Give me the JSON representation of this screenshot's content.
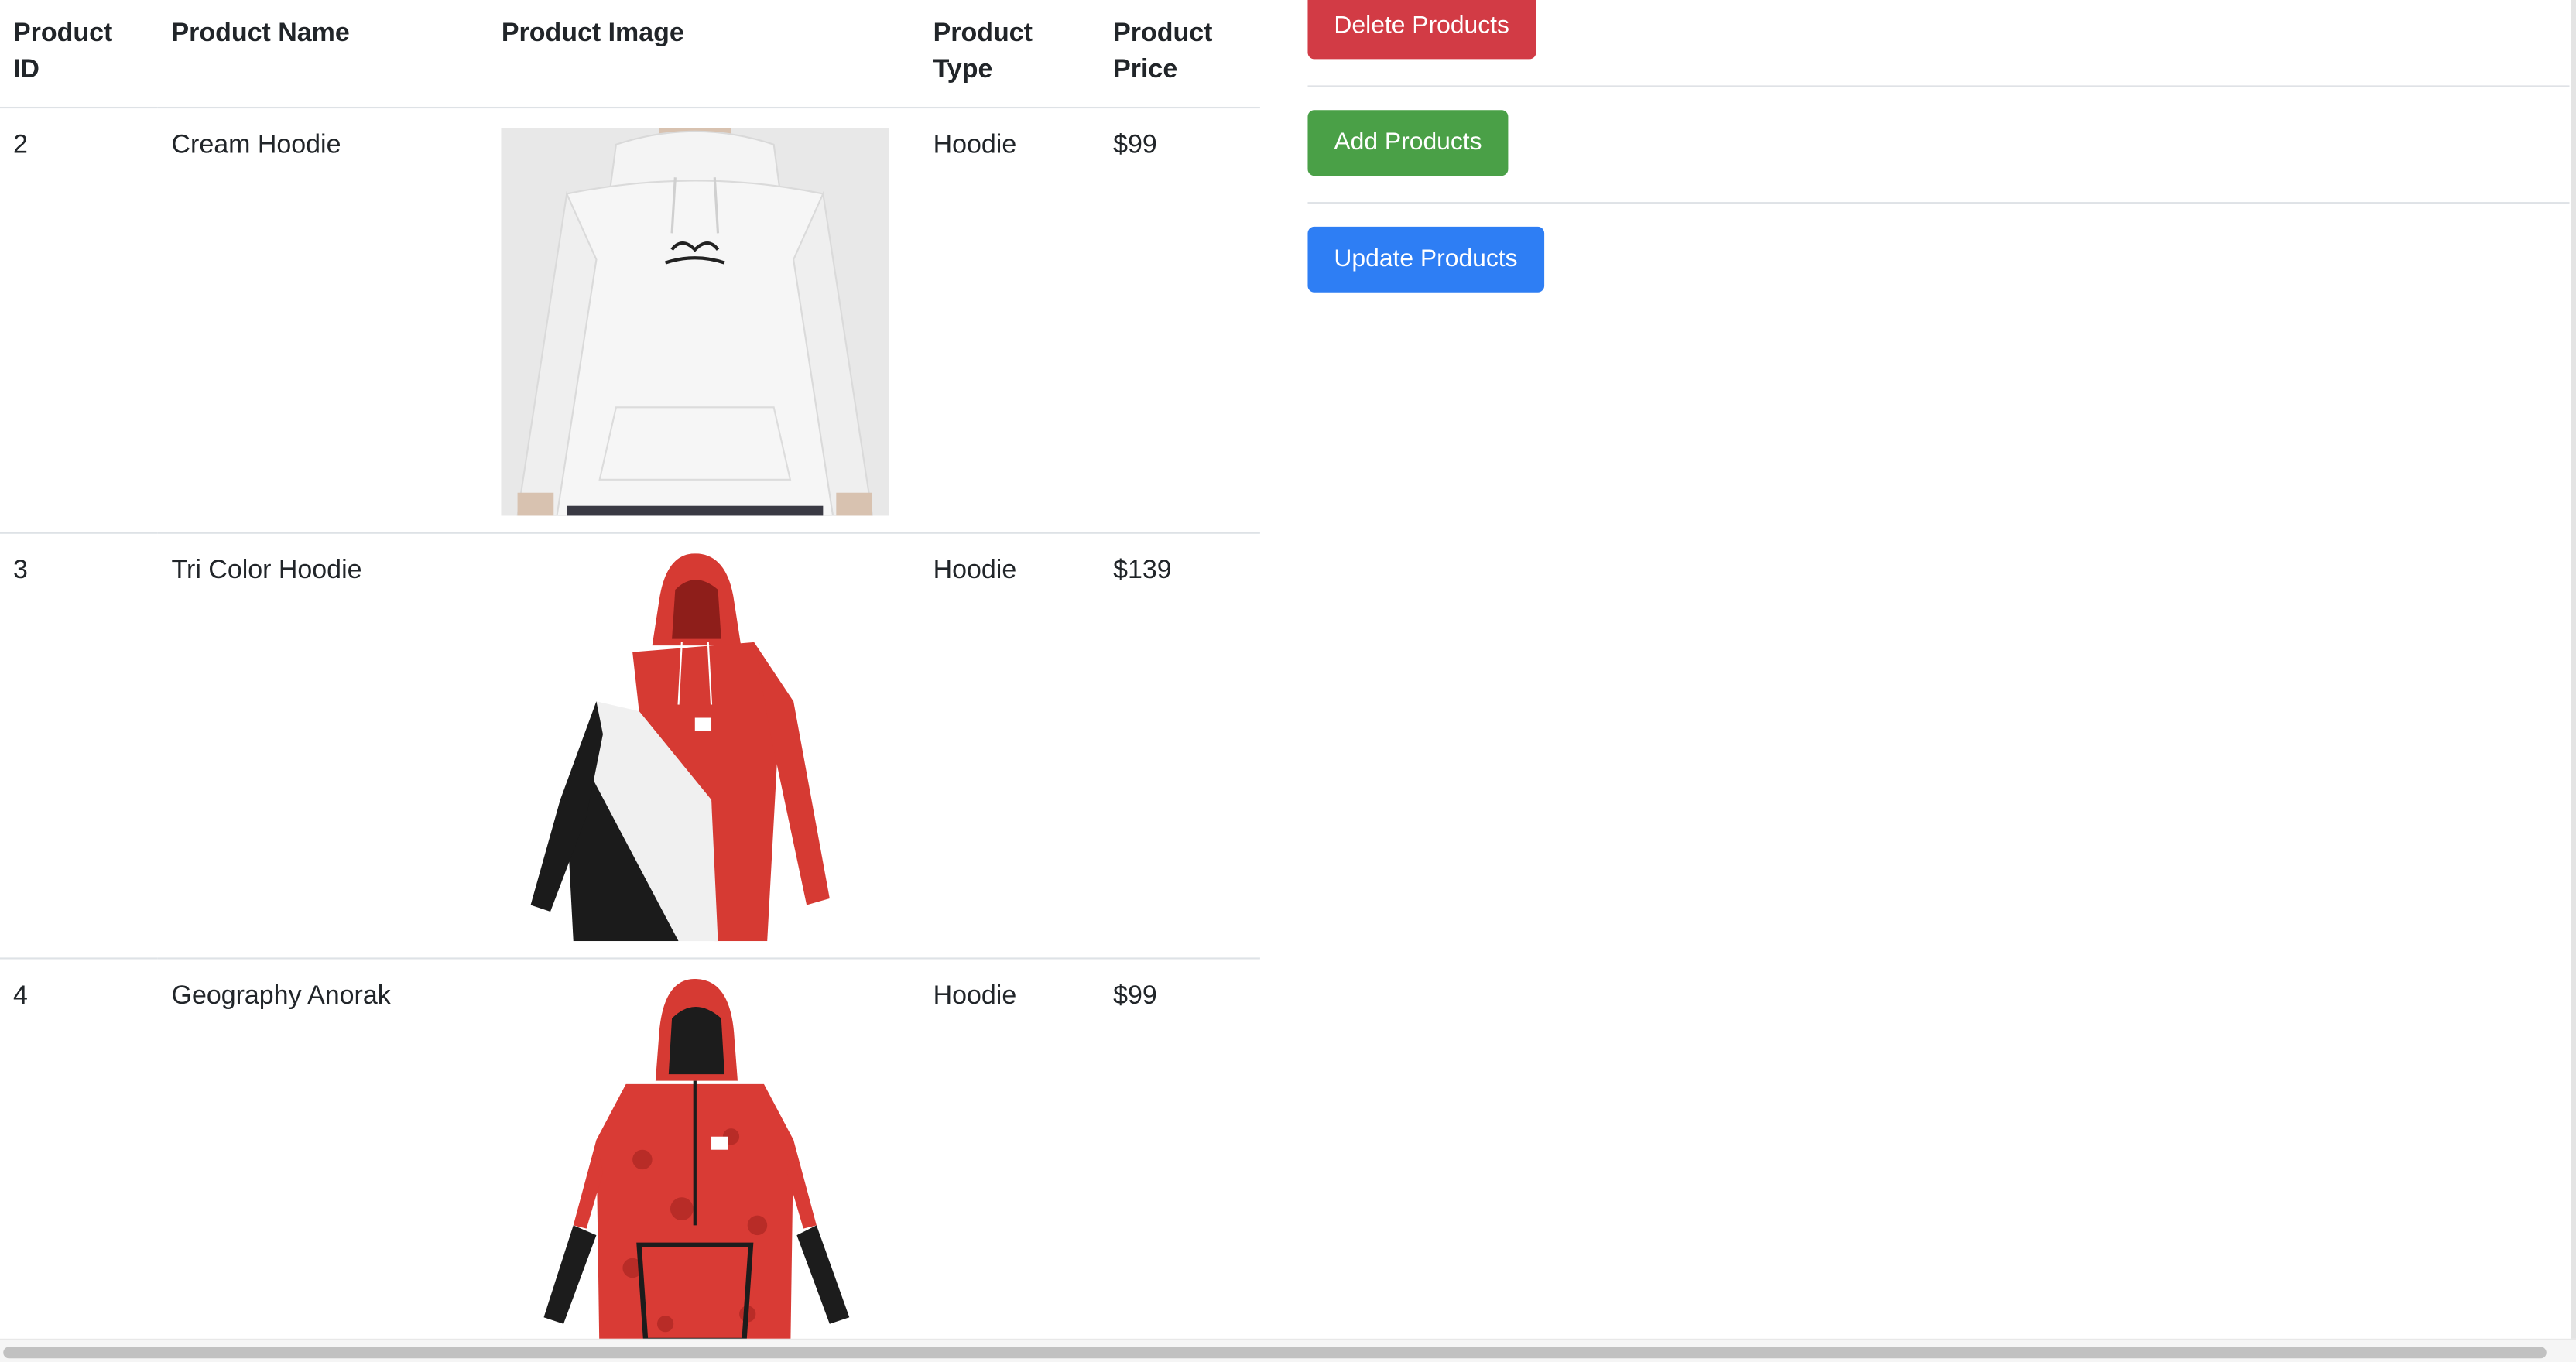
{
  "table": {
    "headers": {
      "id": "Product ID",
      "name": "Product Name",
      "image": "Product Image",
      "type": "Product Type",
      "price": "Product Price"
    },
    "rows": [
      {
        "id": "2",
        "name": "Cream Hoodie",
        "image_icon": "cream-hoodie-image",
        "type": "Hoodie",
        "price": "$99"
      },
      {
        "id": "3",
        "name": "Tri Color Hoodie",
        "image_icon": "tri-color-hoodie-image",
        "type": "Hoodie",
        "price": "$139"
      },
      {
        "id": "4",
        "name": "Geography Anorak",
        "image_icon": "geography-anorak-image",
        "type": "Hoodie",
        "price": "$99"
      }
    ]
  },
  "actions": {
    "delete_label": "Delete Products",
    "add_label": "Add Products",
    "update_label": "Update Products"
  },
  "colors": {
    "delete": "#d23b45",
    "add": "#4aa047",
    "update": "#2e7ef4"
  }
}
